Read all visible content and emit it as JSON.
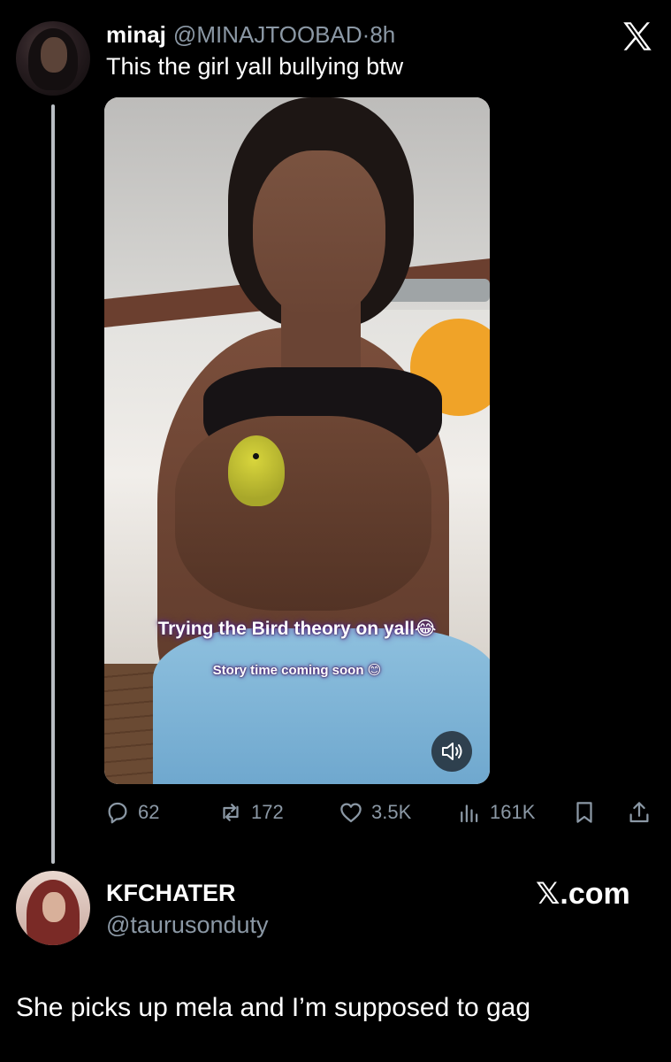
{
  "tweet": {
    "name": "minaj",
    "handle": "@MINAJTOOBAD",
    "separator": "·",
    "time": "8h",
    "text": "This the girl yall bullying btw",
    "media": {
      "caption": "Trying the Bird theory on yall😂",
      "subcaption": "Story time coming soon 😊"
    },
    "actions": {
      "replies": "62",
      "reposts": "172",
      "likes": "3.5K",
      "views": "161K"
    }
  },
  "quote": {
    "name": "KFCHATER",
    "handle": "@taurusonduty",
    "brand": "𝕏.com",
    "text": "She picks up mela and I’m supposed to gag"
  },
  "colors": {
    "background": "#000000",
    "text_primary": "#ffffff",
    "text_secondary": "#8b98a5",
    "thread_line": "#b9bec3",
    "caption_glow": "#5a2b8a"
  },
  "icons": [
    "x-logo-icon",
    "reply-icon",
    "repost-icon",
    "like-icon",
    "views-icon",
    "bookmark-icon",
    "share-icon",
    "speaker-icon"
  ]
}
